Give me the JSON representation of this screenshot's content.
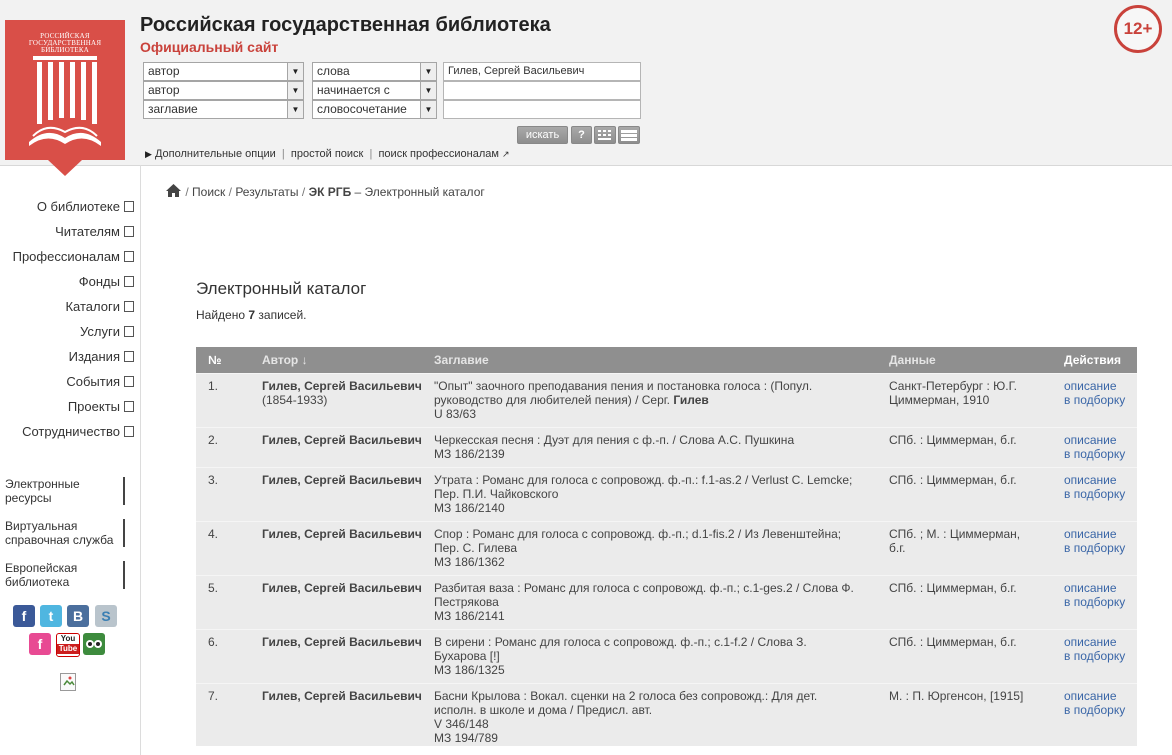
{
  "header": {
    "site_title": "Российская государственная библиотека",
    "site_subtitle": "Официальный сайт",
    "age_badge": "12+",
    "logo_text_line1": "РОССИЙСКАЯ",
    "logo_text_line2": "ГОСУДАРСТВЕННАЯ",
    "logo_text_line3": "БИБЛИОТЕКА"
  },
  "search": {
    "rows": [
      {
        "field": "автор",
        "mode": "слова",
        "value": "Гилев, Сергей Васильевич"
      },
      {
        "field": "автор",
        "mode": "начинается с",
        "value": ""
      },
      {
        "field": "заглавие",
        "mode": "словосочетание",
        "value": ""
      }
    ],
    "search_button": "искать",
    "help_button": "?",
    "links": {
      "advanced": "Дополнительные опции",
      "simple": "простой поиск",
      "pro": "поиск профессионалам"
    }
  },
  "sidebar": {
    "items": [
      {
        "label": "О библиотеке"
      },
      {
        "label": "Читателям"
      },
      {
        "label": "Профессионалам"
      },
      {
        "label": "Фонды"
      },
      {
        "label": "Каталоги"
      },
      {
        "label": "Услуги"
      },
      {
        "label": "Издания"
      },
      {
        "label": "События"
      },
      {
        "label": "Проекты"
      },
      {
        "label": "Сотрудничество"
      }
    ],
    "blocks": [
      {
        "label": "Электронные ресурсы"
      },
      {
        "label": "Виртуальная справочная служба"
      },
      {
        "label": "Европейская библиотека"
      }
    ],
    "social": {
      "facebook": "f",
      "twitter": "t",
      "vk": "B",
      "skype": "S",
      "youtube_line1": "You",
      "youtube_line2": "Tube"
    }
  },
  "breadcrumb": {
    "search": "Поиск",
    "results": "Результаты",
    "catalog": "ЭК РГБ",
    "current": "– Электронный каталог"
  },
  "main": {
    "title": "Электронный каталог",
    "found_prefix": "Найдено",
    "found_count": "7",
    "found_suffix": "записей."
  },
  "table": {
    "headers": {
      "num": "№",
      "author": "Автор ↓",
      "title": "Заглавие",
      "data": "Данные",
      "actions": "Действия"
    },
    "rows": [
      {
        "num": "1.",
        "author": "Гилев, Сергей Васильевич",
        "author_dates": "(1854-1933)",
        "title_text": "\"Опыт\" заочного преподавания пения и постановка голоса : (Попул. руководство для любителей пения) / Серг.",
        "title_bold": "Гилев",
        "codes": [
          "U 83/63"
        ],
        "data": "Санкт-Петербург : Ю.Г. Циммерман, 1910",
        "action1": "описание",
        "action2": "в подборку"
      },
      {
        "num": "2.",
        "author": "Гилев, Сергей Васильевич",
        "author_dates": "",
        "title_text": "Черкесская песня : Дуэт для пения с ф.-п. / Слова А.С. Пушкина",
        "title_bold": "",
        "codes": [
          "МЗ 186/2139"
        ],
        "data": "СПб. : Циммерман, б.г.",
        "action1": "описание",
        "action2": "в подборку"
      },
      {
        "num": "3.",
        "author": "Гилев, Сергей Васильевич",
        "author_dates": "",
        "title_text": "Утрата : Романс для голоса с сопровожд. ф.-п.: f.1-as.2 / Verlust С. Lemcke; Пер. П.И. Чайковского",
        "title_bold": "",
        "codes": [
          "МЗ 186/2140"
        ],
        "data": "СПб. : Циммерман, б.г.",
        "action1": "описание",
        "action2": "в подборку"
      },
      {
        "num": "4.",
        "author": "Гилев, Сергей Васильевич",
        "author_dates": "",
        "title_text": "Спор : Романс для голоса с сопровожд. ф.-п.; d.1-fis.2 / Из Левенштейна; Пер. С. Гилева",
        "title_bold": "",
        "codes": [
          "МЗ 186/1362"
        ],
        "data": "СПб. ; М. : Циммерман, б.г.",
        "action1": "описание",
        "action2": "в подборку"
      },
      {
        "num": "5.",
        "author": "Гилев, Сергей Васильевич",
        "author_dates": "",
        "title_text": "Разбитая ваза : Романс для голоса с сопровожд. ф.-п.; с.1-ges.2 / Слова Ф. Пестрякова",
        "title_bold": "",
        "codes": [
          "МЗ 186/2141"
        ],
        "data": "СПб. : Циммерман, б.г.",
        "action1": "описание",
        "action2": "в подборку"
      },
      {
        "num": "6.",
        "author": "Гилев, Сергей Васильевич",
        "author_dates": "",
        "title_text": "В сирени : Романс для голоса с сопровожд. ф.-п.; с.1-f.2 / Слова З. Бухарова [!]",
        "title_bold": "",
        "codes": [
          "МЗ 186/1325"
        ],
        "data": "СПб. : Циммерман, б.г.",
        "action1": "описание",
        "action2": "в подборку"
      },
      {
        "num": "7.",
        "author": "Гилев, Сергей Васильевич",
        "author_dates": "",
        "title_text": "Басни Крылова : Вокал. сценки на 2 голоса без сопровожд.: Для дет. исполн. в школе и дома / Предисл. авт.",
        "title_bold": "",
        "codes": [
          "V 346/148",
          "МЗ 194/789"
        ],
        "data": "М. : П. Юргенсон, [1915]",
        "action1": "описание",
        "action2": "в подборку"
      }
    ]
  },
  "colors": {
    "brand": "#d94f48",
    "accent_red": "#c9423b",
    "link": "#3a66a7",
    "table_header": "#8f8f8f",
    "table_row": "#ebebeb"
  }
}
